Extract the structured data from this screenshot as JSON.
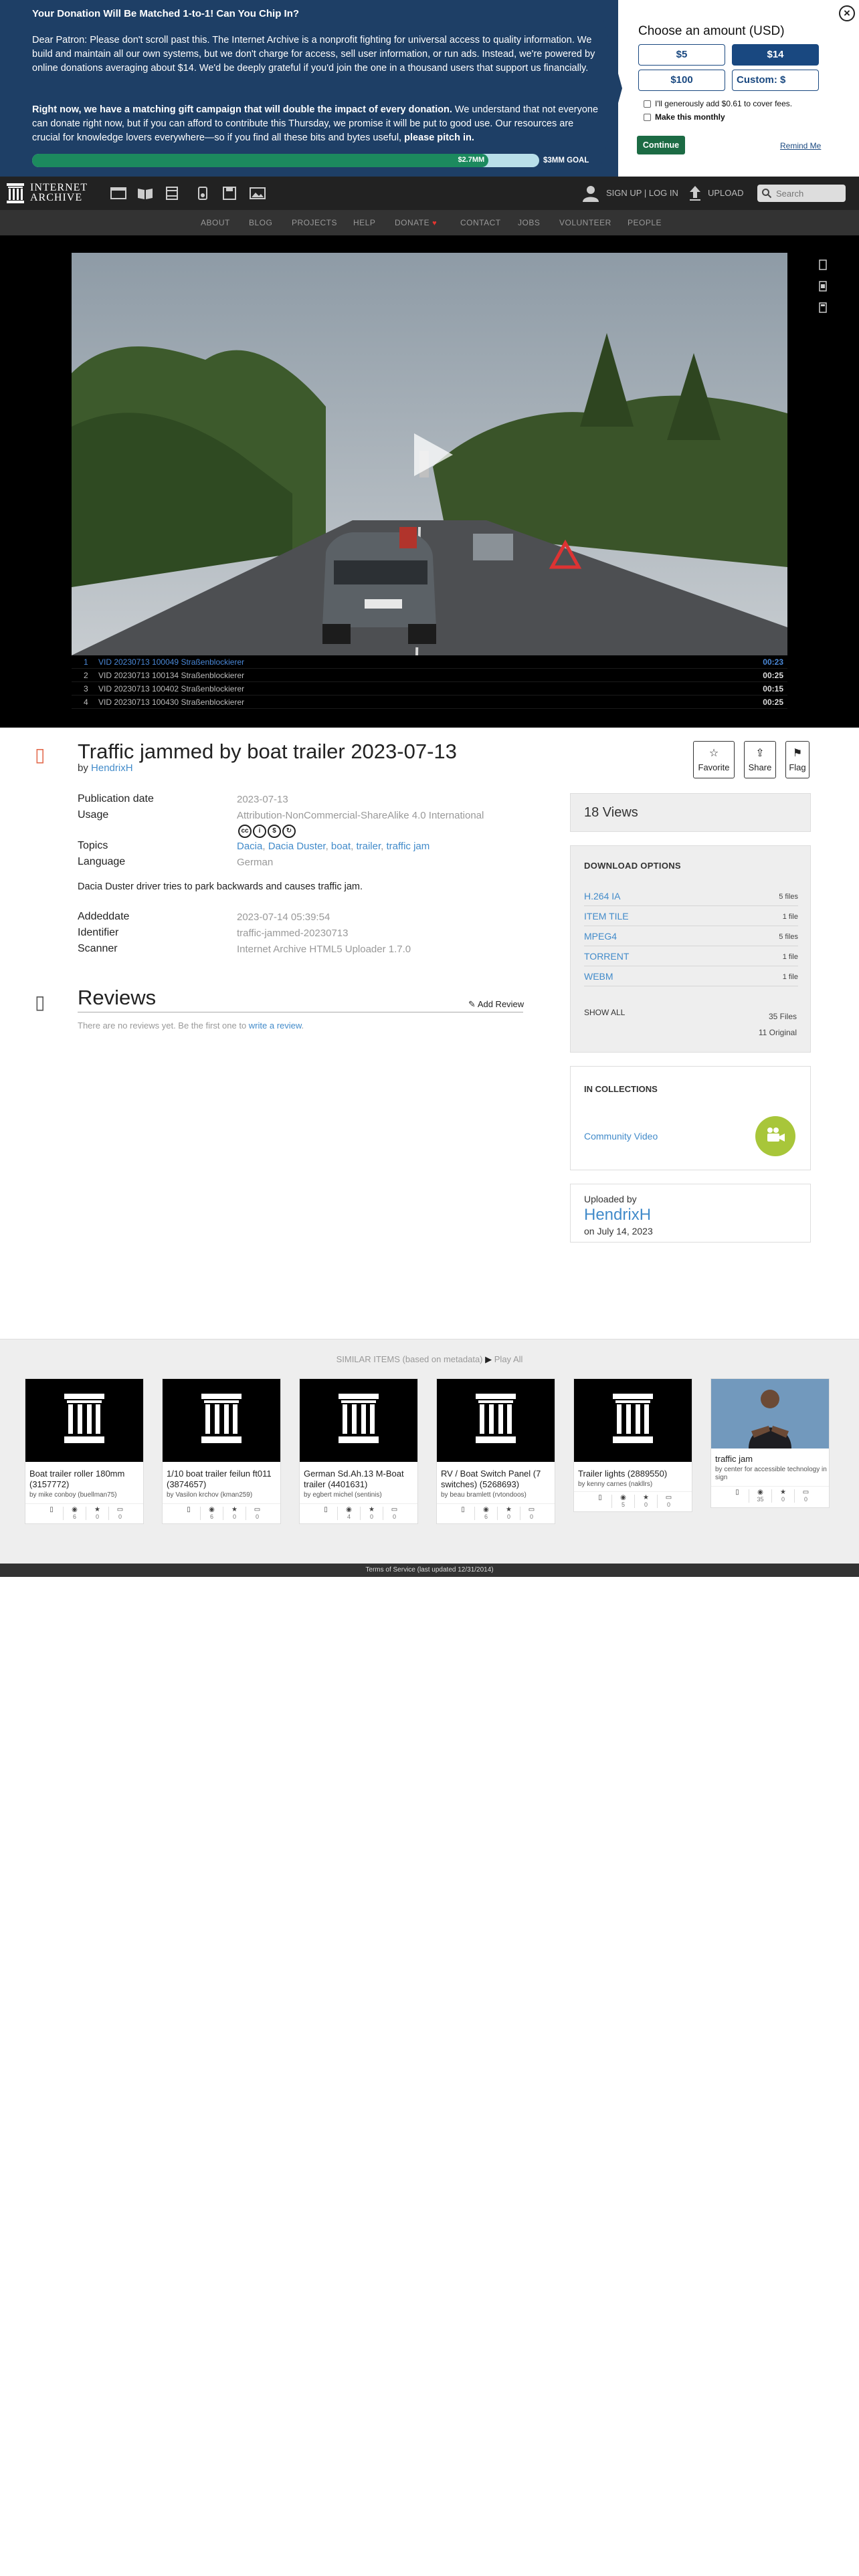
{
  "banner": {
    "title": "Your Donation Will Be Matched 1-to-1! Can You Chip In?",
    "p1": "Dear Patron: Please don't scroll past this. The Internet Archive is a nonprofit fighting for universal access to quality information. We build and maintain all our own systems, but we don't charge for access, sell user information, or run ads. Instead, we're powered by online donations averaging about $14. We'd be deeply grateful if you'd join the one in a thousand users that support us financially.",
    "p2_bold": "Right now, we have a matching gift campaign that will double the impact of every donation.",
    "p2_rest": " We understand that not everyone can donate right now, but if you can afford to contribute this Thursday, we promise it will be put to good use. Our resources are crucial for knowledge lovers everywhere—so if you find all these bits and bytes useful, ",
    "p2_end": "please pitch in.",
    "raised": "$2.7MM",
    "goal": "$3MM GOAL",
    "progress_fraction": 0.9,
    "amount_title": "Choose an amount (USD)",
    "amounts": [
      "$5",
      "$14",
      "$100"
    ],
    "custom_label": "Custom: $",
    "fees_label": "I'll generously add $0.61 to cover fees.",
    "monthly_label": "Make this monthly",
    "continue_label": "Continue",
    "remind_label": "Remind Me",
    "close_label": "×"
  },
  "topnav": {
    "logo_line1": "INTERNET",
    "logo_line2": "ARCHIVE",
    "signup_label": "SIGN UP | LOG IN",
    "upload_label": "UPLOAD",
    "search_placeholder": "Search"
  },
  "subnav": {
    "items": [
      "ABOUT",
      "BLOG",
      "PROJECTS",
      "HELP",
      "DONATE",
      "CONTACT",
      "JOBS",
      "VOLUNTEER",
      "PEOPLE"
    ]
  },
  "playlist": [
    {
      "num": "1",
      "title": "VID 20230713 100049 Straßenblockierer",
      "duration": "00:23"
    },
    {
      "num": "2",
      "title": "VID 20230713 100134 Straßenblockierer",
      "duration": "00:25"
    },
    {
      "num": "3",
      "title": "VID 20230713 100402 Straßenblockierer",
      "duration": "00:15"
    },
    {
      "num": "4",
      "title": "VID 20230713 100430 Straßenblockierer",
      "duration": "00:25"
    }
  ],
  "item": {
    "title": "Traffic jammed by boat trailer 2023-07-13",
    "by_prefix": "by ",
    "creator": "HendrixH",
    "favorite_label": "Favorite",
    "share_label": "Share",
    "flag_label": "Flag",
    "pub_date_key": "Publication date",
    "pub_date": "2023-07-13",
    "usage_key": "Usage",
    "usage": "Attribution-NonCommercial-ShareAlike 4.0 International",
    "topics_key": "Topics",
    "topics": [
      "Dacia",
      "Dacia Duster",
      "boat",
      "trailer",
      "traffic jam"
    ],
    "language_key": "Language",
    "language": "German",
    "description": "Dacia Duster driver tries to park backwards and causes traffic jam.",
    "addeddate_key": "Addeddate",
    "addeddate": "2023-07-14 05:39:54",
    "identifier_key": "Identifier",
    "identifier": "traffic-jammed-20230713",
    "scanner_key": "Scanner",
    "scanner": "Internet Archive HTML5 Uploader 1.7.0"
  },
  "reviews": {
    "title": "Reviews",
    "add_label": "Add Review",
    "empty_prefix": "There are no reviews yet. Be the first one to ",
    "empty_link": "write a review",
    "empty_suffix": "."
  },
  "sidebar": {
    "views": "18 Views",
    "download_title": "DOWNLOAD OPTIONS",
    "downloads": [
      {
        "name": "H.264 IA",
        "count": "5 files"
      },
      {
        "name": "ITEM TILE",
        "count": "1 file"
      },
      {
        "name": "MPEG4",
        "count": "5 files"
      },
      {
        "name": "TORRENT",
        "count": "1 file"
      },
      {
        "name": "WEBM",
        "count": "1 file"
      }
    ],
    "show_all": "SHOW ALL",
    "total_files": "35 Files",
    "original_files": "11 Original",
    "collections_title": "IN COLLECTIONS",
    "collection_name": "Community Video",
    "uploaded_by": "Uploaded by",
    "uploader": "HendrixH",
    "uploaded_on": "on July 14, 2023"
  },
  "similar": {
    "heading": "SIMILAR ITEMS (based on metadata)",
    "play_all": "Play All",
    "items": [
      {
        "title": "Boat trailer roller 180mm (3157772)",
        "by": "by mike conboy (buellman75)",
        "stats": [
          "",
          "6",
          "0",
          "0"
        ]
      },
      {
        "title": "1/10 boat trailer feilun ft011 (3874657)",
        "by": "by Vasilon krchov (kman259)",
        "stats": [
          "",
          "6",
          "0",
          "0"
        ]
      },
      {
        "title": "German Sd.Ah.13 M-Boat trailer (4401631)",
        "by": "by egbert michel (sentinis)",
        "stats": [
          "",
          "4",
          "0",
          "0"
        ]
      },
      {
        "title": "RV / Boat Switch Panel (7 switches) (5268693)",
        "by": "by beau bramlett (rvtondoos)",
        "stats": [
          "",
          "6",
          "0",
          "0"
        ]
      },
      {
        "title": "Trailer lights (2889550)",
        "by": "by kenny carnes (nakllrs)",
        "stats": [
          "",
          "5",
          "0",
          "0"
        ]
      },
      {
        "title": "traffic jam",
        "by": "by center for accessible technology in sign",
        "stats": [
          "",
          "35",
          "0",
          "0"
        ]
      }
    ]
  },
  "footer": {
    "text": "Terms of Service (last updated 12/31/2014)"
  }
}
